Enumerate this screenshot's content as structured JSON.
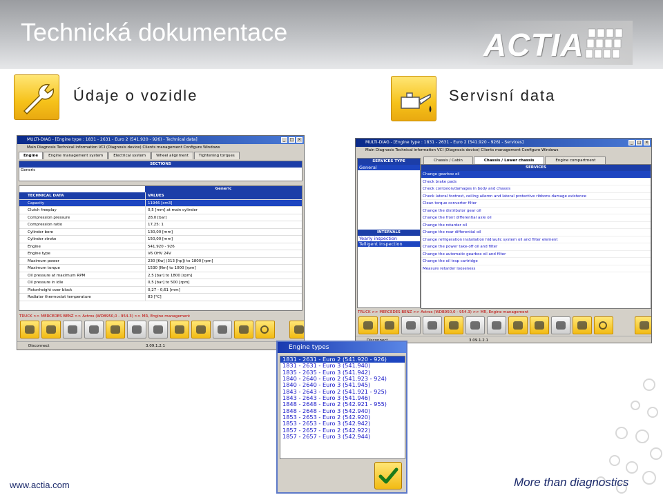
{
  "header": {
    "title": "Technická dokumentace",
    "logo_text": "ACTIA"
  },
  "sections": {
    "left_title": "Údaje o vozidle",
    "right_title": "Servisní data"
  },
  "left_window": {
    "title": "MULTI-DIAG - [Engine type : 1831 - 2631 - Euro 2 (541.920 - 926) - Technical data]",
    "menu": "Main   Diagnosis   Technical information   VCI (Diagnosis device)   Clients management   Configure   Windows",
    "tabs": [
      "Engine",
      "Engine management system",
      "Electrical system",
      "Wheel alignment",
      "Tightening torques"
    ],
    "sections_label": "SECTIONS",
    "sections_item": "Generic",
    "group_label": "Generic",
    "col_headers": [
      "TECHNICAL DATA",
      "VALUES"
    ],
    "rows": [
      [
        "Capacity",
        "11946 [cm3]"
      ],
      [
        "Clutch freeplay",
        "0,5 [mm] at main cylinder"
      ],
      [
        "Compression pressure",
        "28,0 [bar]"
      ],
      [
        "Compression ratio",
        "17,25: 1"
      ],
      [
        "Cylinder bore",
        "130,00 [mm]"
      ],
      [
        "Cylinder stroke",
        "150,00 [mm]"
      ],
      [
        "Engine",
        "541.920 - 926"
      ],
      [
        "Engine type",
        "V6 OHV 24V"
      ],
      [
        "Maximum power",
        "230 [Kw] (313 [hp]) to 1800 [rpm]"
      ],
      [
        "Maximum torque",
        "1530 [Nm] to 1000 [rpm]"
      ],
      [
        "Oil pressure at maximum RPM",
        "2,5 [bar] to 1800 [rpm]"
      ],
      [
        "Oil pressure in idle",
        "0,5 [bar] to 500 [rpm]"
      ],
      [
        "Pistonheight over block",
        "0,27 - 0,61 [mm]"
      ],
      [
        "Radiator thermostat temperature",
        "83 [°C]"
      ]
    ],
    "path": "TRUCK >> MERCEDES BENZ >> Actros (WDB950,0 - 954.3) >> MR, Engine management",
    "status": [
      "Disconnect",
      "3.09.1.2.1"
    ]
  },
  "right_window": {
    "title": "MULTI-DIAG - [Engine type : 1831 - 2631 - Euro 2 (541.920 - 926) - Services]",
    "menu": "Main   Diagnosis   Technical information   VCI (Diagnosis device)   Clients management   Configure   Windows",
    "tabs": [
      "Chassis / Cabin",
      "Chassis / Lower chassis",
      "Engine compartment"
    ],
    "services_type_label": "SERVICES TYPE",
    "services_type_items": [
      "General"
    ],
    "intervals_label": "INTERVALS",
    "intervals_items": [
      "Yearly inspection",
      "Telligent inspection"
    ],
    "services_label": "SERVICES",
    "services": [
      "Change gearbox oil",
      "Check brake pads",
      "Check corrosion/damages in body and chassis",
      "Check lateral footrest, ceiling aileron and lateral protective ribbons damage existence",
      "Clean torque converter filter",
      "Change the distributor gear oil",
      "Change the front differential axle oil",
      "Change the retarder oil",
      "Change the rear differential oil",
      "Change refrigeration installation hidraulic system oil and filter element",
      "Change the power take-off oil and filter",
      "Change the automatic gearbox oil and filter",
      "Change the oil trap cartridge",
      "Measure retarder looseness"
    ],
    "path": "TRUCK >> MERCEDES BENZ >> Actros (WDB950,0 - 954.3) >> MR, Engine management",
    "status": [
      "Disconnect",
      "3.09.1.2.1"
    ]
  },
  "dialog": {
    "title": "Engine types",
    "items": [
      "1831 - 2631 - Euro 2 (541.920 - 926)",
      "1831 - 2631 - Euro 3 (541.940)",
      "1835 - 2635 - Euro 3 (541.942)",
      "1840 - 2640 - Euro 2 (541.923 - 924)",
      "1840 - 2640 - Euro 3 (541.945)",
      "1843 - 2643 - Euro 2 (541.921 - 925)",
      "1843 - 2643 - Euro 3 (541.946)",
      "1848 - 2648 - Euro 2 (542.921 - 955)",
      "1848 - 2648 - Euro 3 (542.940)",
      "1853 - 2653 - Euro 2 (542.920)",
      "1853 - 2653 - Euro 3 (542.942)",
      "1857 - 2657 - Euro 2 (542.922)",
      "1857 - 2657 - Euro 3 (542.944)"
    ]
  },
  "footer": {
    "url": "www.actia.com",
    "tagline": "More than diagnostics"
  },
  "colors": {
    "accent_blue": "#1d45c0",
    "brand_navy": "#1b2a6b",
    "tile_yellow": "#f6c21a"
  }
}
